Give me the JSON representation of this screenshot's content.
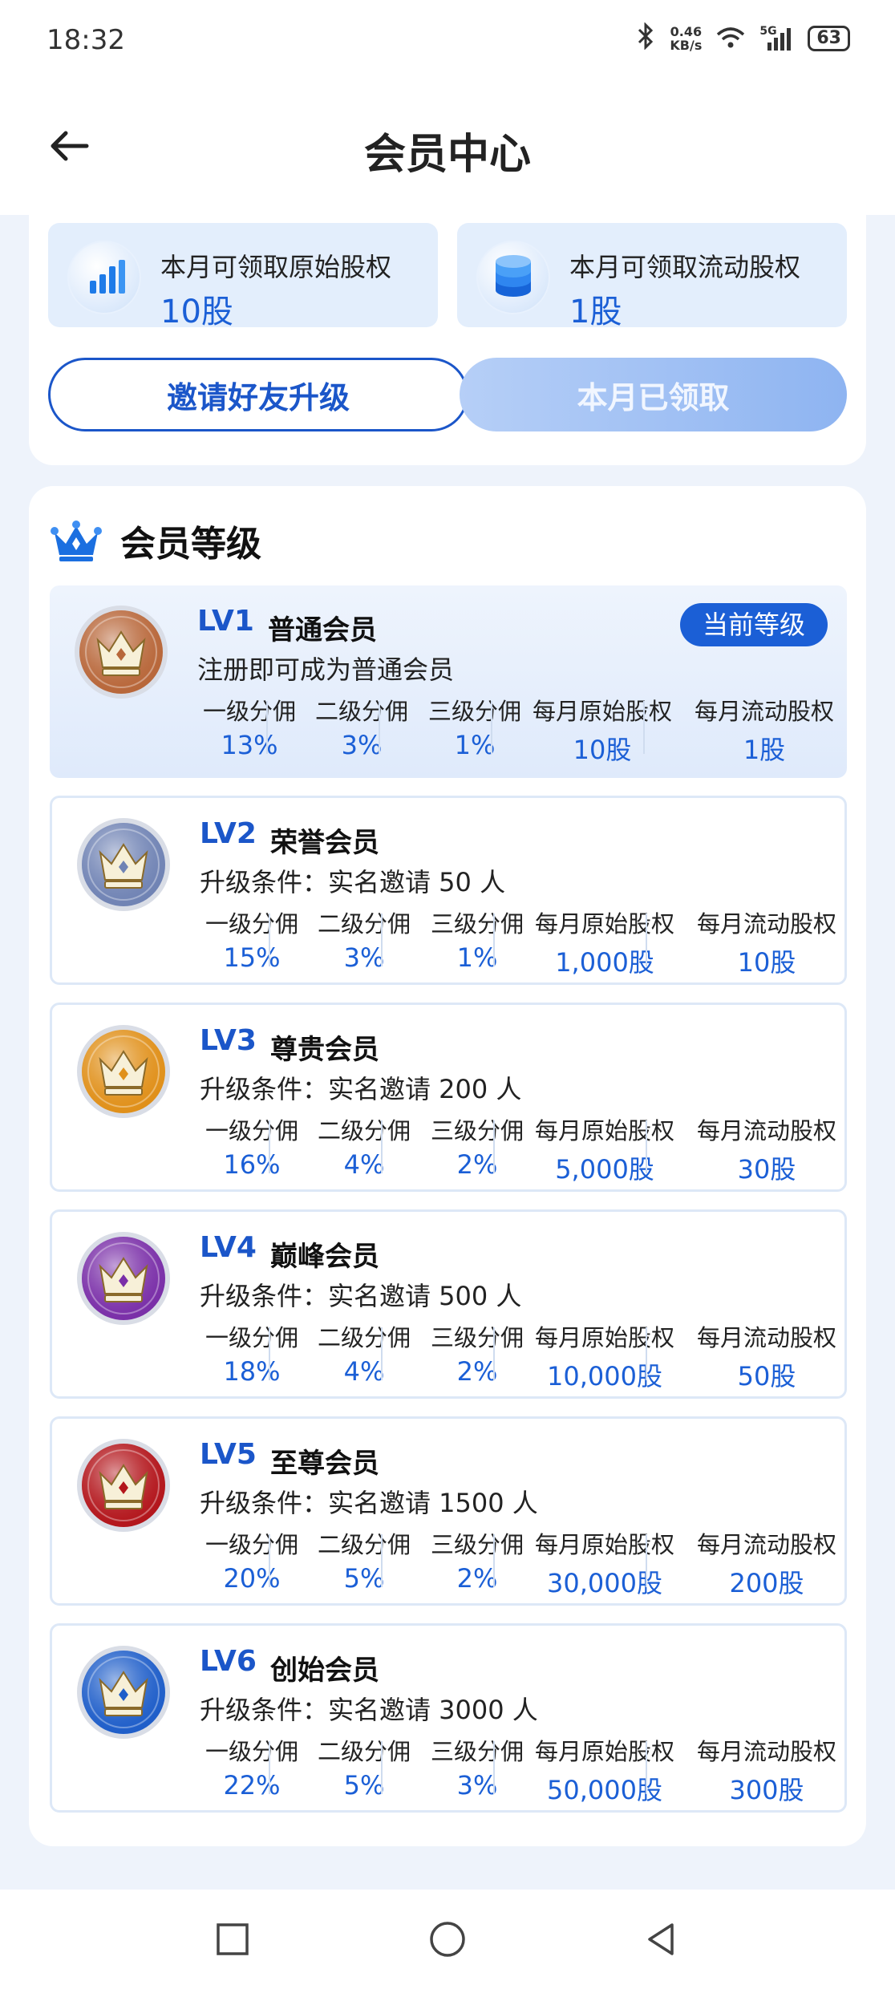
{
  "status_bar": {
    "time": "18:32",
    "net_speed": "0.46",
    "net_unit": "KB/s",
    "network": "5G",
    "battery": "63"
  },
  "header": {
    "title": "会员中心"
  },
  "summary": {
    "original_equity_label": "本月可领取原始股权",
    "original_equity_value": "10股",
    "liquid_equity_label": "本月可领取流动股权",
    "liquid_equity_value": "1股",
    "invite_button": "邀请好友升级",
    "claimed_button": "本月已领取"
  },
  "levels_section": {
    "title": "会员等级",
    "current_badge": "当前等级",
    "columns": [
      "一级分佣",
      "二级分佣",
      "三级分佣",
      "每月原始股权",
      "每月流动股权"
    ],
    "levels": [
      {
        "code": "LV1",
        "name": "普通会员",
        "condition": "注册即可成为普通会员",
        "values": [
          "13%",
          "3%",
          "1%",
          "10股",
          "1股"
        ],
        "medal_color": "#b8673a"
      },
      {
        "code": "LV2",
        "name": "荣誉会员",
        "condition": "升级条件：实名邀请 50 人",
        "values": [
          "15%",
          "3%",
          "1%",
          "1,000股",
          "10股"
        ],
        "medal_color": "#7083b4"
      },
      {
        "code": "LV3",
        "name": "尊贵会员",
        "condition": "升级条件：实名邀请 200 人",
        "values": [
          "16%",
          "4%",
          "2%",
          "5,000股",
          "30股"
        ],
        "medal_color": "#e0901a"
      },
      {
        "code": "LV4",
        "name": "巅峰会员",
        "condition": "升级条件：实名邀请 500 人",
        "values": [
          "18%",
          "4%",
          "2%",
          "10,000股",
          "50股"
        ],
        "medal_color": "#7a2fa8"
      },
      {
        "code": "LV5",
        "name": "至尊会员",
        "condition": "升级条件：实名邀请 1500 人",
        "values": [
          "20%",
          "5%",
          "2%",
          "30,000股",
          "200股"
        ],
        "medal_color": "#b3161c"
      },
      {
        "code": "LV6",
        "name": "创始会员",
        "condition": "升级条件：实名邀请 3000 人",
        "values": [
          "22%",
          "5%",
          "3%",
          "50,000股",
          "300股"
        ],
        "medal_color": "#1f5ec9"
      }
    ]
  },
  "colors": {
    "accent": "#1b5fd6",
    "page_bg": "#eef3fb"
  },
  "icons": {
    "back": "arrow-left-icon",
    "bar_chart": "bar-chart-icon",
    "coins": "coin-stack-icon",
    "crown": "crown-icon",
    "nav_recent": "square-icon",
    "nav_home": "circle-icon",
    "nav_back": "triangle-back-icon"
  }
}
